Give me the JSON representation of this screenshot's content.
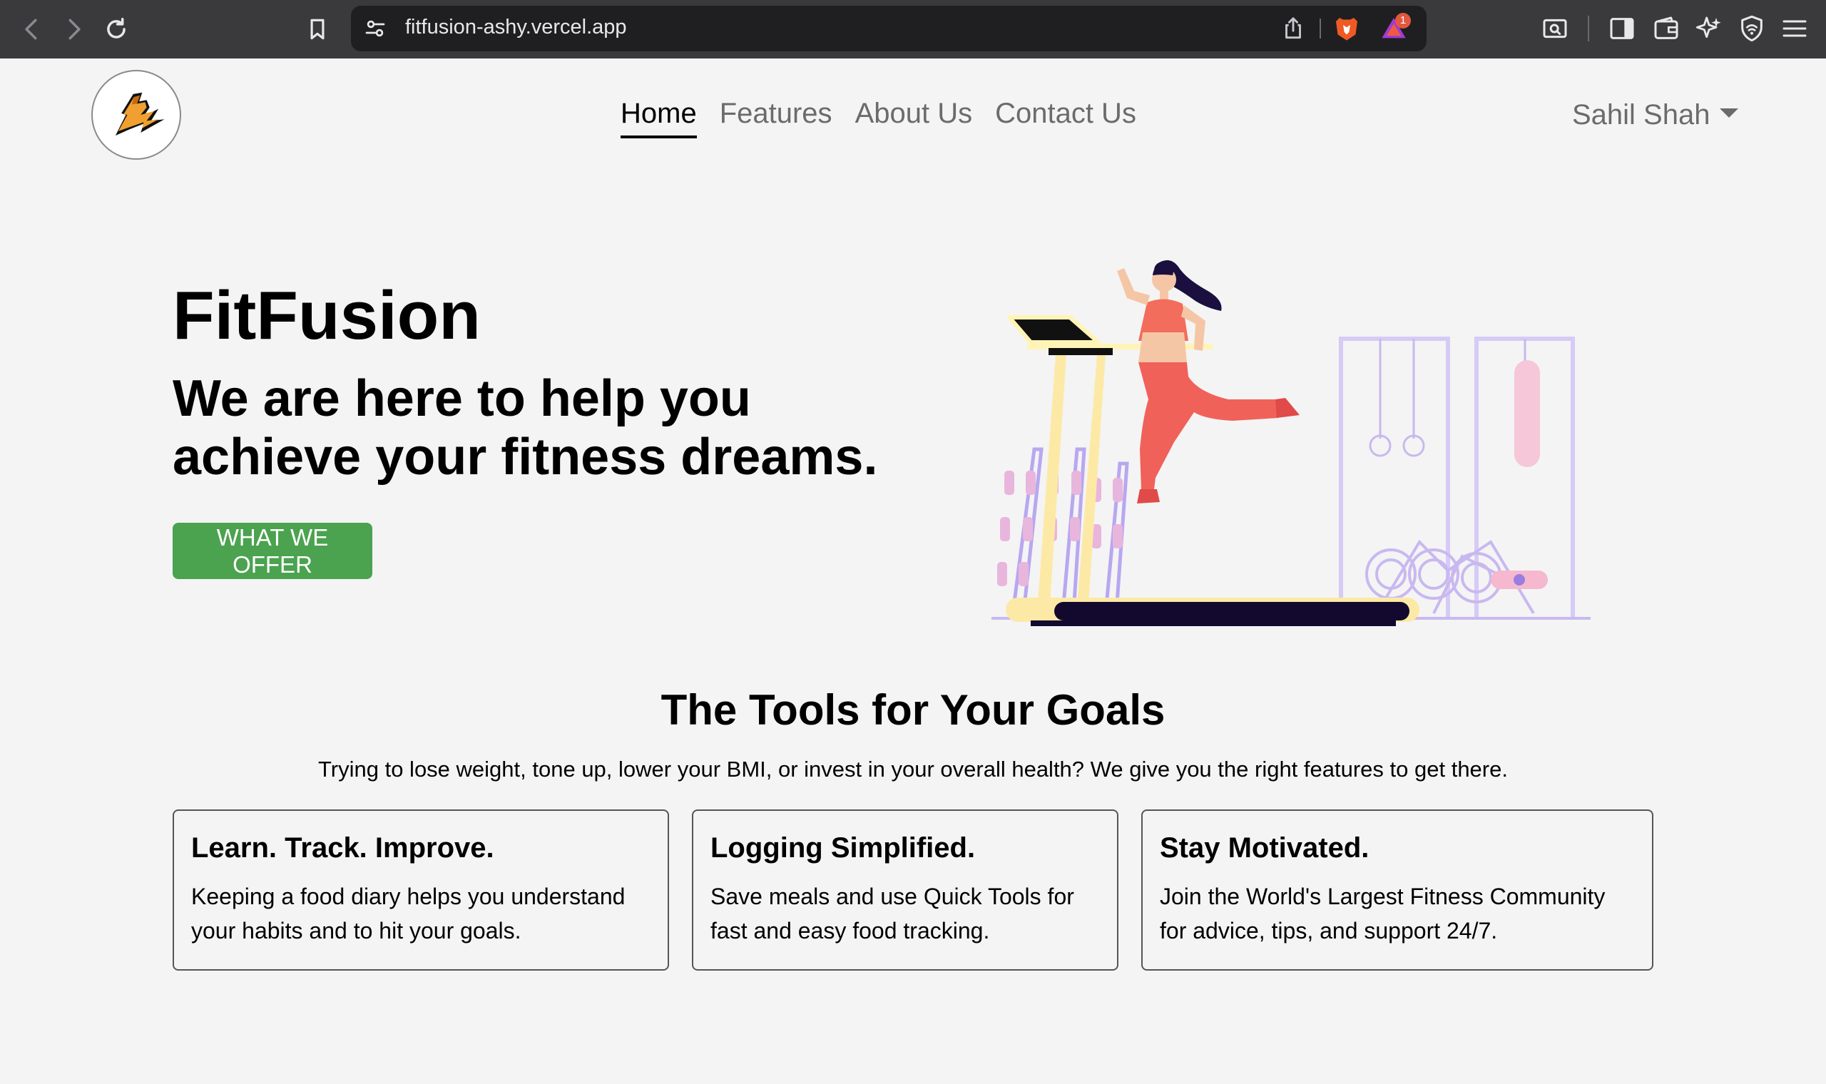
{
  "browser": {
    "url": "fitfusion-ashy.vercel.app",
    "rewards_badge": "1",
    "icons": [
      "back-icon",
      "forward-icon",
      "reload-icon",
      "bookmark-icon",
      "site-settings-icon",
      "share-icon",
      "brave-shields-icon",
      "brave-rewards-icon",
      "screenshot-search-icon",
      "sidebar-icon",
      "wallet-icon",
      "leo-ai-icon",
      "vpn-icon",
      "menu-icon"
    ]
  },
  "nav": {
    "items": [
      {
        "label": "Home",
        "active": true
      },
      {
        "label": "Features",
        "active": false
      },
      {
        "label": "About Us",
        "active": false
      },
      {
        "label": "Contact Us",
        "active": false
      }
    ],
    "user_name": "Sahil Shah"
  },
  "hero": {
    "title": "FitFusion",
    "subtitle": "We are here to help you achieve your fitness dreams.",
    "cta_label": "WHAT WE OFFER"
  },
  "tools": {
    "title": "The Tools for Your Goals",
    "description": "Trying to lose weight, tone up, lower your BMI, or invest in your overall health? We give you the right features to get there.",
    "cards": [
      {
        "title": "Learn. Track. Improve.",
        "text": "Keeping a food diary helps you understand your habits and to hit your goals."
      },
      {
        "title": "Logging Simplified.",
        "text": "Save meals and use Quick Tools for fast and easy food tracking."
      },
      {
        "title": "Stay Motivated.",
        "text": "Join the World's Largest Fitness Community for advice, tips, and support 24/7."
      }
    ]
  },
  "colors": {
    "page_bg": "#f4f4f4",
    "chrome_bg": "#3a3a3d",
    "cta_green": "#4ba24f",
    "nav_inactive": "#6b6b6b"
  }
}
